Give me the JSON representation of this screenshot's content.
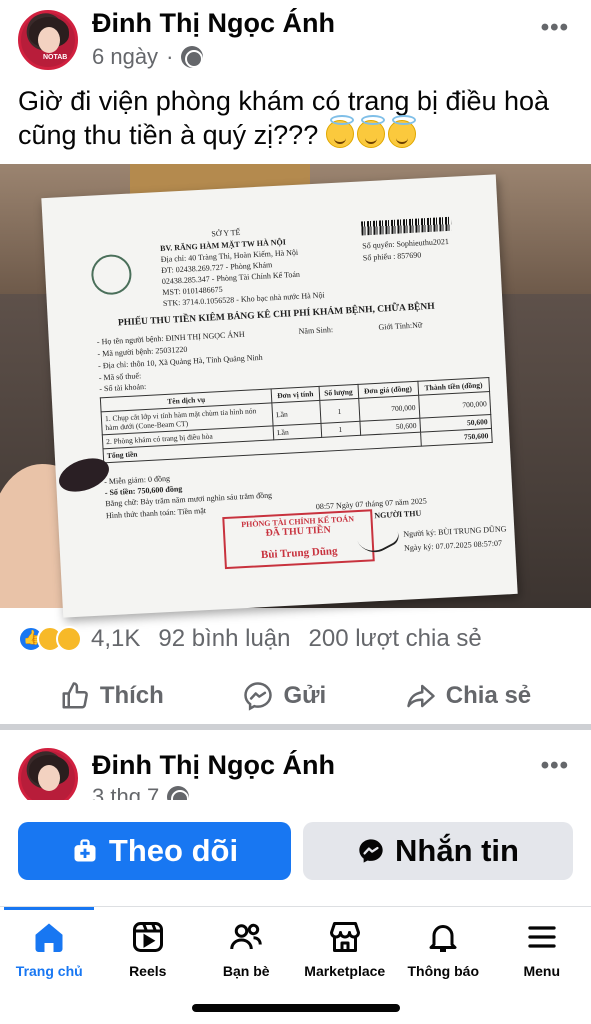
{
  "post": {
    "author": "Đinh Thị Ngọc Ánh",
    "time": "6 ngày",
    "separator": "·",
    "more": "•••",
    "caption": "Giờ đi viện phòng khám có trang bị điều hoà cũng thu tiền à quý zị???",
    "avatar_tag": "NOTAB"
  },
  "receipt": {
    "header_1": "SỞ Y TẾ",
    "header_2": "BV. RĂNG HÀM MẶT TW HÀ NỘI",
    "header_3": "Địa chỉ: 40 Tràng Thi, Hoàn Kiếm, Hà Nội",
    "header_4": "ĐT: 02438.269.727 - Phòng Khám",
    "header_5": "02438.285.347 - Phòng Tài Chính Kế Toán",
    "header_6": "MST: 0101486675",
    "header_7": "STK: 3714.0.1056528 - Kho bạc nhà nước Hà Nội",
    "quyen": "Số quyển: Sophieuthu2021",
    "so_phieu": "Số phiếu : 857690",
    "title": "PHIẾU THU TIỀN KIÊM BẢNG KÊ CHI PHÍ KHÁM BỆNH, CHỮA BỆNH",
    "patient": "- Họ tên người bệnh: ĐINH THỊ NGỌC ÁNH",
    "nam_sinh": "Năm Sinh:",
    "gioi_tinh": "Giới Tính:Nữ",
    "ma_nb": "- Mã người bệnh: 25031220",
    "dia_chi": "- Địa chỉ: thôn 10, Xã Quảng Hà, Tỉnh Quảng Ninh",
    "ma_thue": "- Mã số thuế:",
    "so_tk": "- Số tài khoản:",
    "columns": [
      "Tên dịch vụ",
      "Đơn vị tính",
      "Số lượng",
      "Đơn giá (đồng)",
      "Thành tiền (đồng)"
    ],
    "rows": [
      [
        "1. Chụp cắt lớp vi tính hàm mặt chùm tia hình nón hàm dưới (Cone-Beam CT)",
        "Lần",
        "1",
        "700,000",
        "700,000"
      ],
      [
        "2. Phòng khám có trang bị điều hòa",
        "Lần",
        "1",
        "50,600",
        "50,600"
      ]
    ],
    "total_label": "Tổng tiền",
    "total_value": "750,600",
    "mien_giam": "- Miễn giảm: 0 đồng",
    "so_tien": "- Số tiền: 750,600 đồng",
    "bang_chu": "Bằng chữ: Bảy trăm năm mươi nghìn sáu trăm đồng",
    "hinh_thuc": "Hình thức thanh toán: Tiền mặt",
    "date": "08:57 Ngày 07 tháng 07 năm 2025",
    "nguoi_thu": "NGƯỜI THU",
    "nguoi_ky": "Người ký: BÙI TRUNG DŨNG",
    "ngay_ky": "Ngày ký: 07.07.2025 08:57:07",
    "stamp_top": "PHÒNG TÀI CHÍNH KẾ TOÁN",
    "stamp_mid": "ĐÃ THU TIỀN",
    "stamp_name": "Bùi Trung Dũng"
  },
  "stats": {
    "reactions_count": "4,1K",
    "comments": "92 bình luận",
    "shares": "200 lượt chia sẻ"
  },
  "actions": {
    "like": "Thích",
    "send": "Gửi",
    "share": "Chia sẻ"
  },
  "post2": {
    "author": "Đinh Thị Ngọc Ánh",
    "time": "3 thg 7",
    "more": "•••"
  },
  "cta": {
    "follow": "Theo dõi",
    "message": "Nhắn tin"
  },
  "tabs": [
    {
      "label": "Trang chủ",
      "icon": "home-icon"
    },
    {
      "label": "Reels",
      "icon": "reels-icon"
    },
    {
      "label": "Bạn bè",
      "icon": "friends-icon"
    },
    {
      "label": "Marketplace",
      "icon": "marketplace-icon"
    },
    {
      "label": "Thông báo",
      "icon": "bell-icon"
    },
    {
      "label": "Menu",
      "icon": "menu-icon"
    }
  ],
  "colors": {
    "accent": "#1877f2",
    "secondary_text": "#65676b",
    "button_grey": "#e4e6eb"
  }
}
